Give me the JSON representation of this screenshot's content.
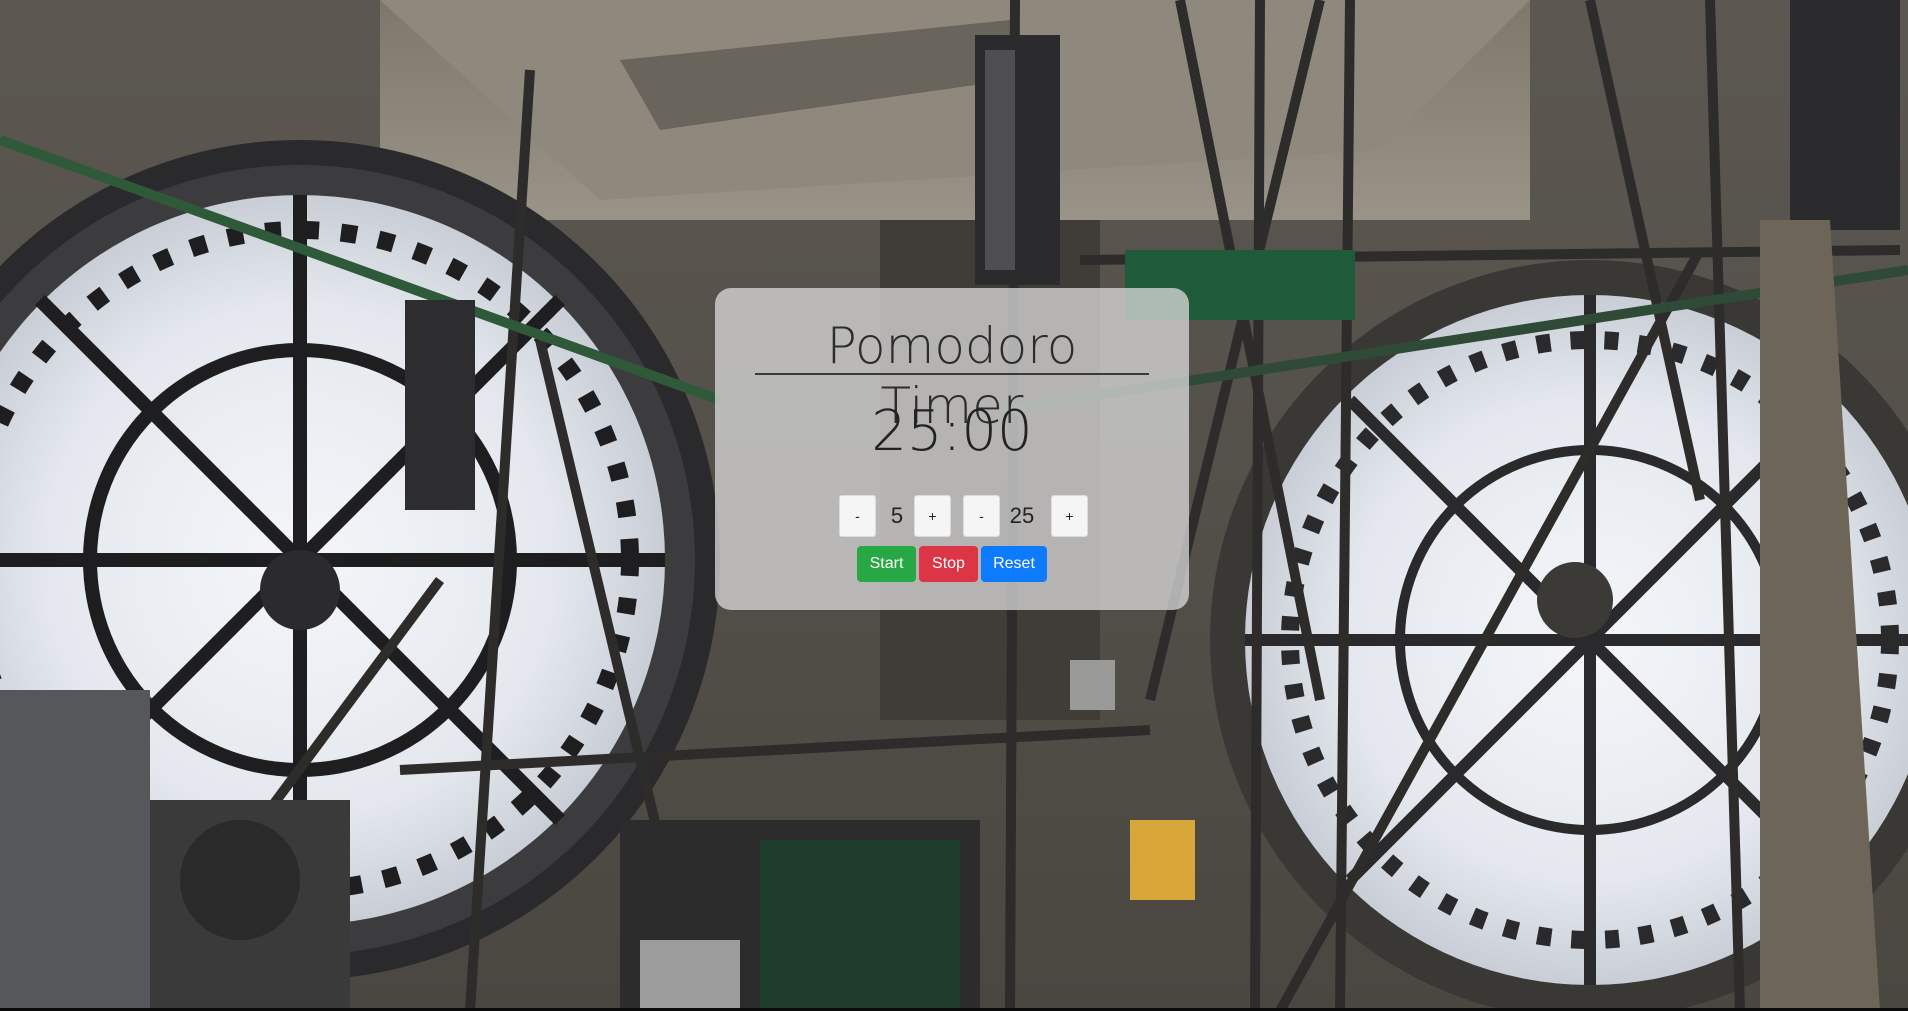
{
  "app": {
    "title": "Pomodoro Timer",
    "display_time": "25:00"
  },
  "break_length": {
    "decrement_label": "-",
    "value": "5",
    "increment_label": "+"
  },
  "session_length": {
    "decrement_label": "-",
    "value": "25",
    "increment_label": "+"
  },
  "actions": {
    "start_label": "Start",
    "stop_label": "Stop",
    "reset_label": "Reset"
  },
  "colors": {
    "start": "#28a745",
    "stop": "#dc3545",
    "reset": "#0d7bff"
  }
}
